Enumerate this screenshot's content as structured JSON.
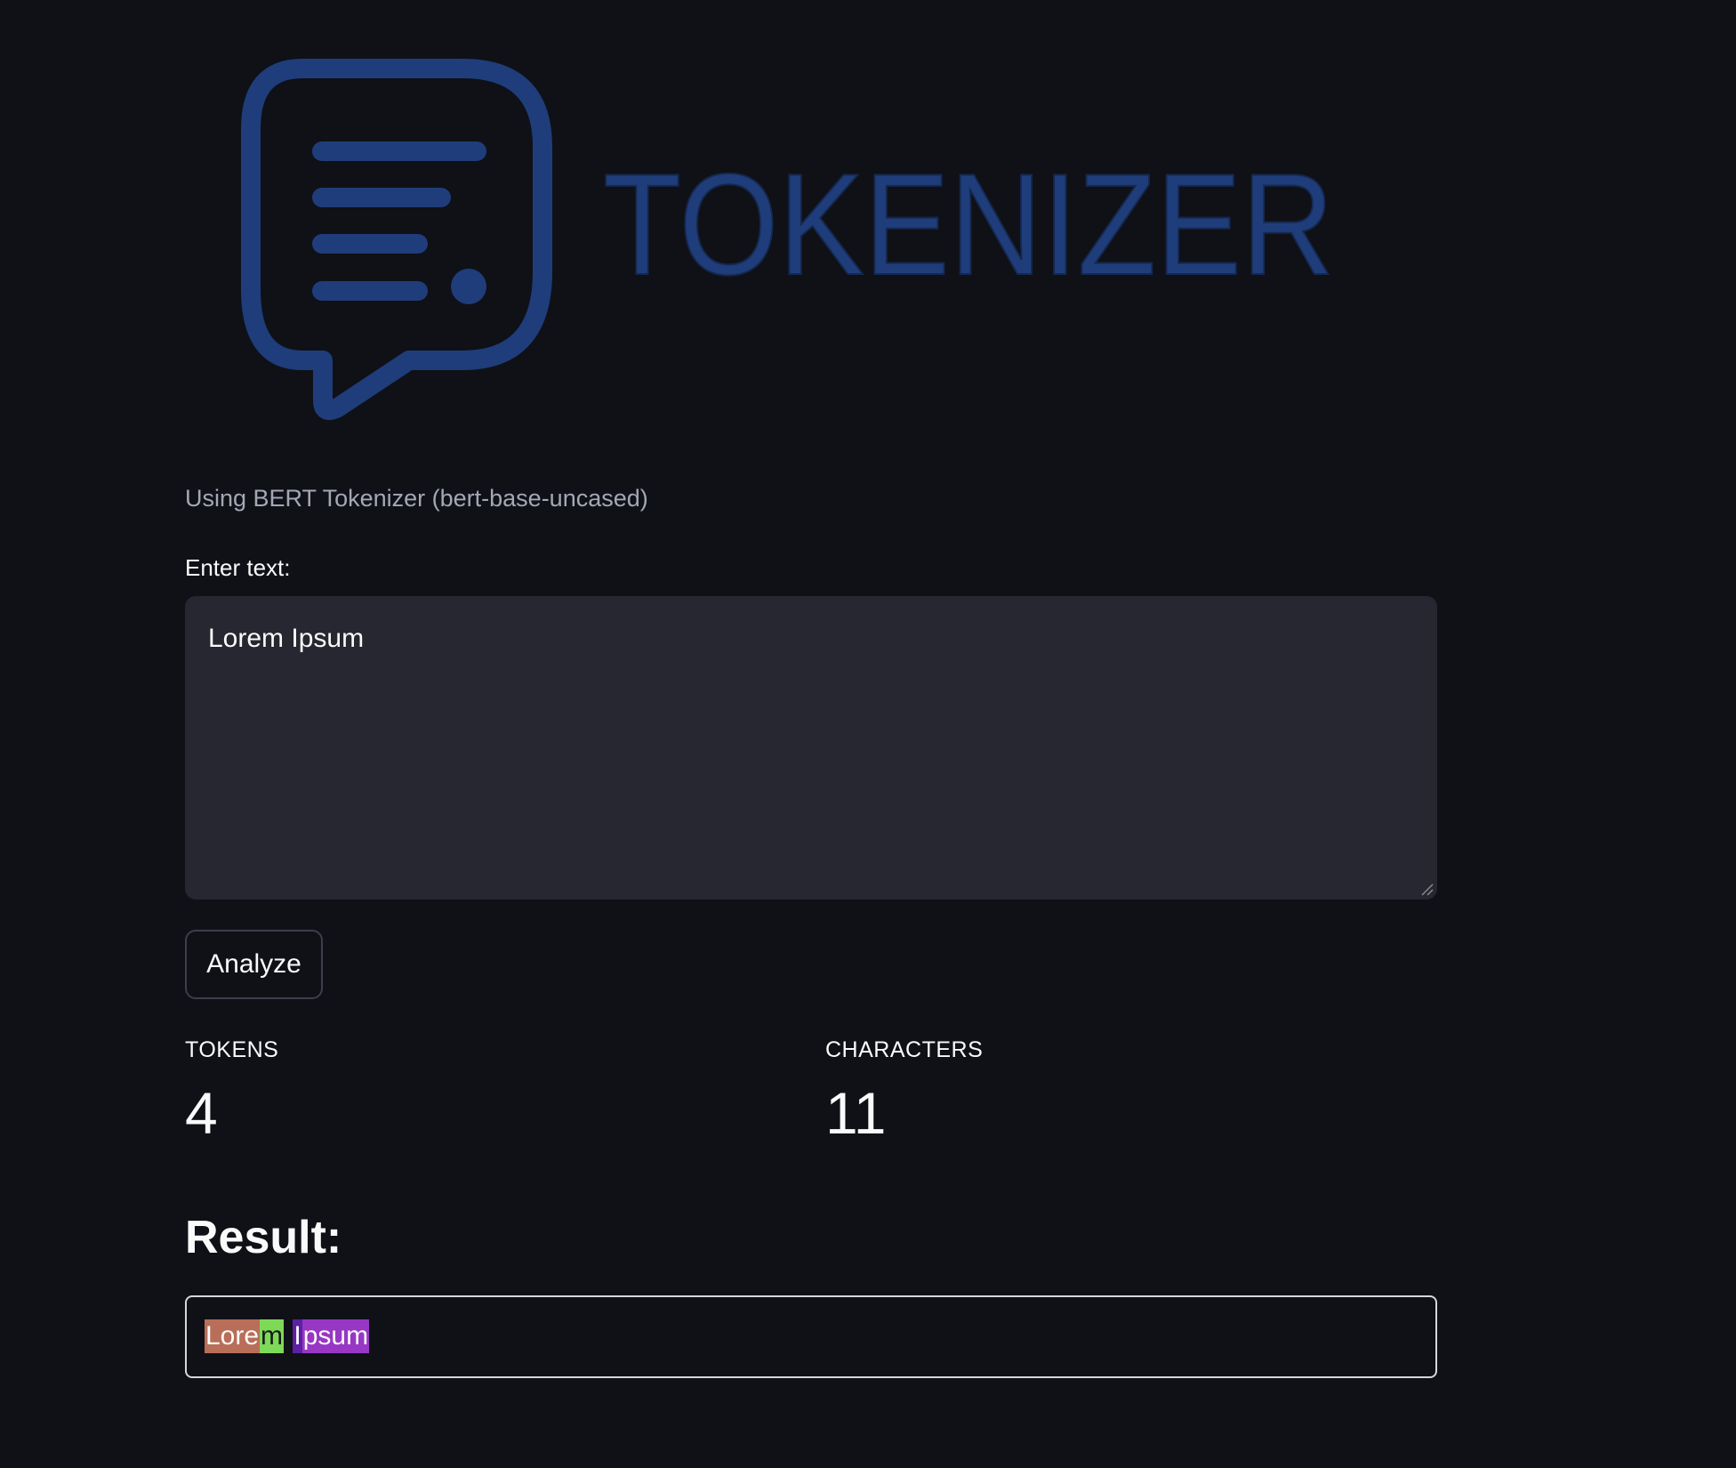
{
  "header": {
    "logo_text": "TOKENIZER",
    "logo_color": "#1f3d7a",
    "logo_icon": "chat-document-icon"
  },
  "subtitle": "Using BERT Tokenizer (bert-base-uncased)",
  "input": {
    "label": "Enter text:",
    "value": "Lorem Ipsum"
  },
  "analyze_button": {
    "label": "Analyze"
  },
  "metrics": {
    "tokens_label": "TOKENS",
    "tokens_value": "4",
    "characters_label": "CHARACTERS",
    "characters_value": "11"
  },
  "result": {
    "heading": "Result:",
    "tokens": [
      {
        "text": "Lore",
        "color": "#b86e58"
      },
      {
        "text": "m",
        "color": "#7ed957"
      },
      {
        "text": " ",
        "color": "transparent"
      },
      {
        "text": "I",
        "color": "#5c1fa6"
      },
      {
        "text": "psum",
        "color": "#9737c4"
      }
    ]
  }
}
